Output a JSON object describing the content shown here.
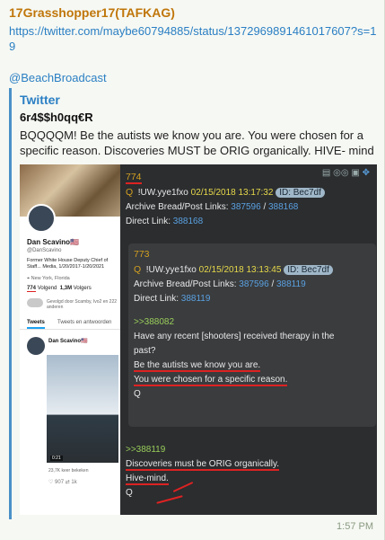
{
  "message": {
    "sender": "17Grasshopper17(TAFKAG)",
    "link1": "https://twitter.com/maybe60794885/status/1372969891461017607?s=19",
    "link2": "@BeachBroadcast",
    "time": "1:57 PM"
  },
  "preview": {
    "site": "Twitter",
    "title": "6r4$$h0qq€R",
    "description": "BQQQQM! Be the autists we know you are. You were chosen for a specific reason. Discoveries MUST be ORIG organically. HIVE- mind"
  },
  "twitter": {
    "name": "Dan Scavino🇺🇸",
    "handle": "@DanScavino",
    "bio": "Former White House Deputy Chief of Staff... Media, 1/20/2017-1/20/2021",
    "location": "New York, Florida",
    "following_count": "774",
    "following_label": "Volgend",
    "followers_count": "1,3M",
    "followers_label": "Volgers",
    "followed_by": "Gevolgd door Scamby, Ivo2 en 222 anderen",
    "tab_tweets": "Tweets",
    "tab_replies": "Tweets en antwoorden",
    "post_name": "Dan Scavino🇺🇸",
    "duration": "0:21",
    "views": "23,7K keer bekeken",
    "actions": "♡ 907   ⇄ 1k"
  },
  "qpost1": {
    "number": "774",
    "marker": "Q",
    "trip": "!UW.yye1fxo",
    "date": "02/15/2018 13:17:32",
    "id": "ID: Bec7df",
    "archive_label": "Archive Bread/Post Links:",
    "archive_a": "387596",
    "sep": "/",
    "archive_b": "388168",
    "direct_label": "Direct Link:",
    "direct": "388168"
  },
  "qpost2": {
    "number": "773",
    "marker": "Q",
    "trip": "!UW.yye1fxo",
    "date": "02/15/2018 13:13:45",
    "id": "ID: Bec7df",
    "archive_label": "Archive Bread/Post Links:",
    "archive_a": "387596",
    "sep": "/",
    "archive_b": "388119",
    "direct_label": "Direct Link:",
    "direct": "388119",
    "ref": ">>388082",
    "line1": "Have any recent [shooters] received therapy in the",
    "line2": "past?",
    "line3": "Be the autists we know you are.",
    "line4": "You were chosen for a specific reason.",
    "sig": "Q"
  },
  "qpost3": {
    "ref": ">>388119",
    "line1": "Discoveries must be ORIG organically.",
    "line2": "Hive-mind.",
    "sig": "Q"
  }
}
